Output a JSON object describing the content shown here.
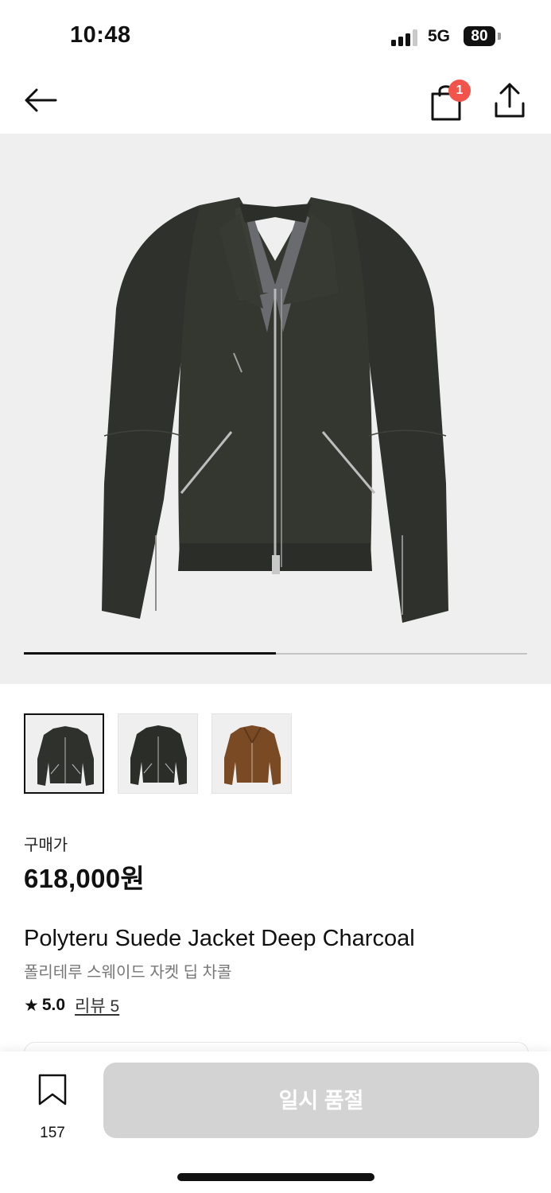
{
  "status_bar": {
    "time": "10:48",
    "network": "5G",
    "battery": "80"
  },
  "header": {
    "cart_count": "1"
  },
  "gallery": {
    "progress_fraction": 0.5
  },
  "thumbnails": [
    {
      "color": "deep-charcoal",
      "selected": true
    },
    {
      "color": "deep-charcoal",
      "selected": false
    },
    {
      "color": "brown",
      "selected": false
    }
  ],
  "pricing": {
    "label": "구매가",
    "price": "618,000원"
  },
  "product": {
    "name": "Polyteru Suede Jacket Deep Charcoal",
    "name_kr": "폴리테루 스웨이드 자켓 딥 차콜",
    "rating": "5.0",
    "review_link": "리뷰 5"
  },
  "bottom_bar": {
    "bookmark_count": "157",
    "action_label": "일시 품절"
  },
  "colors": {
    "badge": "#f2544b",
    "jacket": "#2e312c",
    "jacket_brown": "#7a4a24",
    "disabled_button": "#d3d3d3"
  }
}
